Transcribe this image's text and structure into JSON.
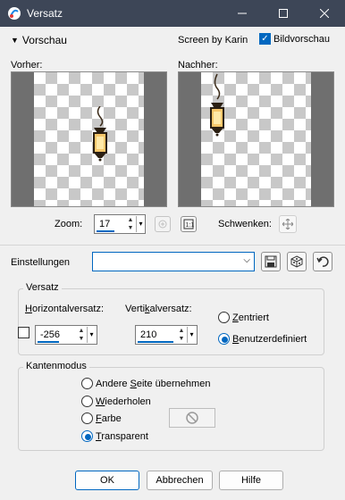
{
  "window": {
    "title": "Versatz",
    "minimize_icon": "minimize-icon",
    "maximize_icon": "maximize-icon",
    "close_icon": "close-icon"
  },
  "preview_section": {
    "toggle_label": "Vorschau",
    "screen_by": "Screen by Karin",
    "live_preview_label": "Bildvorschau",
    "live_preview_checked": true,
    "before_label": "Vorher:",
    "after_label": "Nachher:"
  },
  "zoom": {
    "label": "Zoom:",
    "value": "17",
    "pan_label": "Schwenken:"
  },
  "settings": {
    "label": "Einstellungen",
    "preset_value": ""
  },
  "offset_group": {
    "title": "Versatz",
    "horizontal_label": "Horizontalversatz:",
    "horizontal_value": "-256",
    "vertical_label": "Vertikalversatz:",
    "vertical_value": "210",
    "centered_label": "Zentriert",
    "custom_label": "Benutzerdefiniert",
    "selected": "custom"
  },
  "edge_group": {
    "title": "Kantenmodus",
    "options": [
      "Andere Seite übernehmen",
      "Wiederholen",
      "Farbe",
      "Transparent"
    ],
    "selected": "Transparent"
  },
  "buttons": {
    "ok": "OK",
    "cancel": "Abbrechen",
    "help": "Hilfe"
  },
  "colors": {
    "titlebar": "#3d4657",
    "accent": "#0067c0",
    "dialog_bg": "#f0f0f0"
  }
}
